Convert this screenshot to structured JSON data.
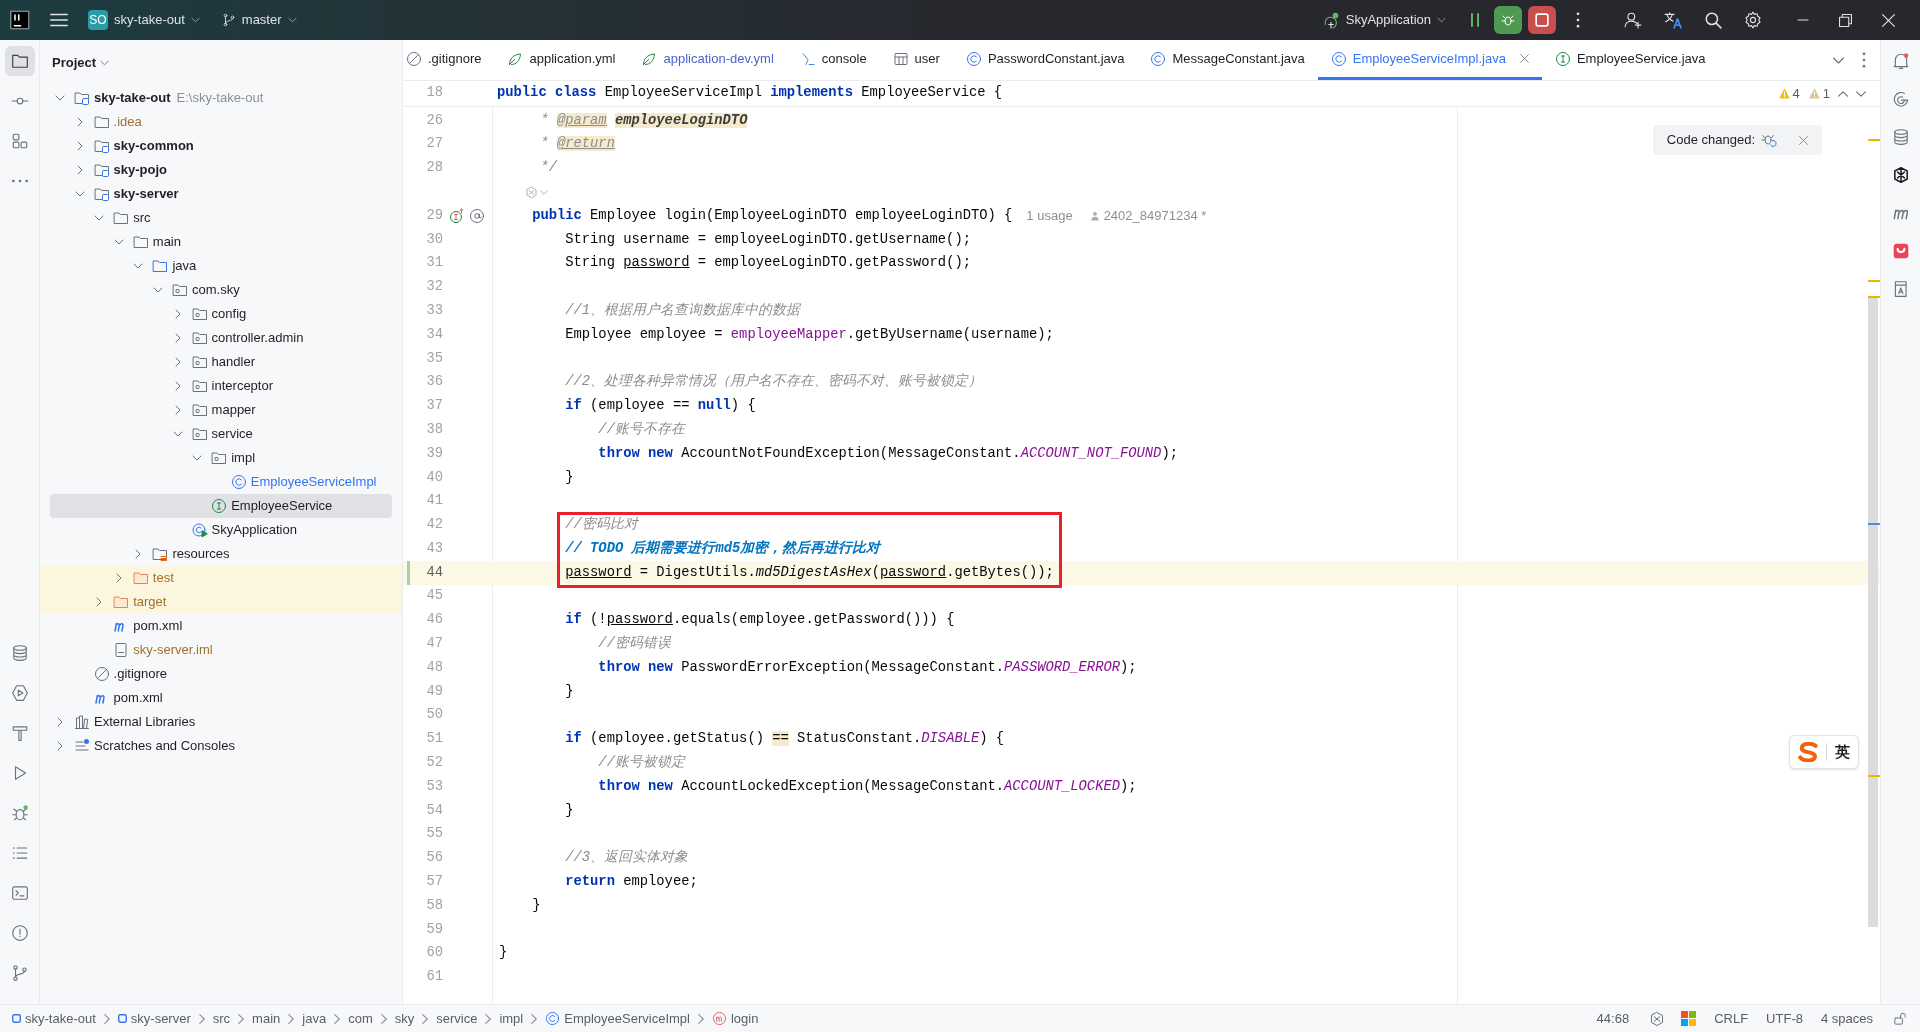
{
  "title_bar": {
    "project_badge": "SO",
    "project": "sky-take-out",
    "branch": "master",
    "run_config": "SkyApplication"
  },
  "left_toolbar": {
    "top": [
      {
        "kind": "folder",
        "selected": true
      },
      {
        "kind": "commit",
        "selected": false
      },
      {
        "kind": "structure",
        "selected": false
      },
      {
        "kind": "more",
        "selected": false
      }
    ],
    "bottom": [
      {
        "kind": "database",
        "selected": false
      },
      {
        "kind": "services",
        "selected": false
      },
      {
        "kind": "build",
        "selected": false
      },
      {
        "kind": "run",
        "selected": false
      },
      {
        "kind": "debug",
        "selected": false
      },
      {
        "kind": "todo",
        "selected": false
      },
      {
        "kind": "terminal",
        "selected": false
      },
      {
        "kind": "problems",
        "selected": false
      },
      {
        "kind": "git",
        "selected": false
      }
    ]
  },
  "right_toolbar": [
    {
      "kind": "bell",
      "selected": false
    },
    {
      "kind": "spiral",
      "selected": false
    },
    {
      "kind": "database",
      "selected": false
    },
    {
      "kind": "hex",
      "selected": false
    },
    {
      "kind": "m",
      "selected": false
    },
    {
      "kind": "app",
      "selected": false
    },
    {
      "kind": "book",
      "selected": false
    }
  ],
  "project_panel": {
    "title": "Project",
    "tree": [
      {
        "label": "sky-take-out",
        "kind": "module",
        "hint": "E:\\sky-take-out",
        "expanded": true,
        "selected": false,
        "ignored": false,
        "modified": false,
        "children": [
          {
            "label": ".idea",
            "kind": "folder",
            "expanded": false,
            "selected": false,
            "ignored": true,
            "modified": false
          },
          {
            "label": "sky-common",
            "kind": "module",
            "expanded": false,
            "selected": false,
            "ignored": false,
            "modified": false
          },
          {
            "label": "sky-pojo",
            "kind": "module",
            "expanded": false,
            "selected": false,
            "ignored": false,
            "modified": false
          },
          {
            "label": "sky-server",
            "kind": "module",
            "expanded": true,
            "selected": false,
            "ignored": false,
            "modified": false,
            "children": [
              {
                "label": "src",
                "kind": "folder",
                "expanded": true,
                "selected": false,
                "ignored": false,
                "modified": false,
                "children": [
                  {
                    "label": "main",
                    "kind": "folder",
                    "expanded": true,
                    "selected": false,
                    "ignored": false,
                    "modified": false,
                    "children": [
                      {
                        "label": "java",
                        "kind": "source",
                        "expanded": true,
                        "selected": false,
                        "ignored": false,
                        "modified": false,
                        "children": [
                          {
                            "label": "com.sky",
                            "kind": "package",
                            "expanded": true,
                            "selected": false,
                            "ignored": false,
                            "modified": false,
                            "children": [
                              {
                                "label": "config",
                                "kind": "package",
                                "expanded": false,
                                "selected": false,
                                "ignored": false,
                                "modified": false
                              },
                              {
                                "label": "controller.admin",
                                "kind": "package",
                                "expanded": false,
                                "selected": false,
                                "ignored": false,
                                "modified": false
                              },
                              {
                                "label": "handler",
                                "kind": "package",
                                "expanded": false,
                                "selected": false,
                                "ignored": false,
                                "modified": false
                              },
                              {
                                "label": "interceptor",
                                "kind": "package",
                                "expanded": false,
                                "selected": false,
                                "ignored": false,
                                "modified": false
                              },
                              {
                                "label": "mapper",
                                "kind": "package",
                                "expanded": false,
                                "selected": false,
                                "ignored": false,
                                "modified": false
                              },
                              {
                                "label": "service",
                                "kind": "package",
                                "expanded": true,
                                "selected": false,
                                "ignored": false,
                                "modified": false,
                                "children": [
                                  {
                                    "label": "impl",
                                    "kind": "package",
                                    "expanded": true,
                                    "selected": false,
                                    "ignored": false,
                                    "modified": false,
                                    "children": [
                                      {
                                        "label": "EmployeeServiceImpl",
                                        "kind": "class",
                                        "selected": false,
                                        "ignored": false,
                                        "modified": true
                                      }
                                    ]
                                  },
                                  {
                                    "label": "EmployeeService",
                                    "kind": "interface",
                                    "selected": true,
                                    "ignored": false,
                                    "modified": false
                                  }
                                ]
                              },
                              {
                                "label": "SkyApplication",
                                "kind": "app-class",
                                "selected": false,
                                "ignored": false,
                                "modified": false
                              }
                            ]
                          }
                        ]
                      },
                      {
                        "label": "resources",
                        "kind": "resources",
                        "expanded": false,
                        "selected": false,
                        "ignored": false,
                        "modified": false
                      }
                    ]
                  },
                  {
                    "label": "test",
                    "kind": "excluded",
                    "expanded": false,
                    "selected": false,
                    "ignored": true,
                    "modified": false
                  }
                ]
              },
              {
                "label": "target",
                "kind": "excluded",
                "expanded": false,
                "selected": false,
                "ignored": true,
                "modified": false
              },
              {
                "label": "pom.xml",
                "kind": "m-file",
                "selected": false,
                "ignored": false,
                "modified": false
              },
              {
                "label": "sky-server.iml",
                "kind": "iml",
                "selected": false,
                "ignored": true,
                "modified": false
              }
            ]
          },
          {
            "label": ".gitignore",
            "kind": "gitignore",
            "selected": false,
            "ignored": false,
            "modified": false
          },
          {
            "label": "pom.xml",
            "kind": "m-file",
            "selected": false,
            "ignored": false,
            "modified": false
          }
        ]
      },
      {
        "label": "External Libraries",
        "kind": "libraries",
        "expanded": false,
        "selected": false,
        "ignored": false,
        "modified": false
      },
      {
        "label": "Scratches and Consoles",
        "kind": "scratches",
        "expanded": false,
        "selected": false,
        "ignored": false,
        "modified": false
      }
    ]
  },
  "tabs": [
    {
      "label": ".gitignore",
      "kind": "gitignore",
      "selected": false,
      "modified": false
    },
    {
      "label": "application.yml",
      "kind": "yml",
      "selected": false,
      "modified": false
    },
    {
      "label": "application-dev.yml",
      "kind": "yml",
      "selected": false,
      "modified": true
    },
    {
      "label": "console",
      "kind": "console",
      "selected": false,
      "modified": false
    },
    {
      "label": "user",
      "kind": "table",
      "selected": false,
      "modified": false
    },
    {
      "label": "PasswordConstant.java",
      "kind": "class",
      "selected": false,
      "modified": false
    },
    {
      "label": "MessageConstant.java",
      "kind": "class",
      "selected": false,
      "modified": false
    },
    {
      "label": "EmployeeServiceImpl.java",
      "kind": "class",
      "selected": true,
      "modified": false
    },
    {
      "label": "EmployeeService.java",
      "kind": "interface",
      "selected": false,
      "modified": false
    }
  ],
  "editor": {
    "sticky_line": {
      "number": "18",
      "tokens": [
        {
          "kind": "keyword",
          "text": "public class"
        },
        {
          "kind": "text",
          "text": " EmployeeServiceImpl "
        },
        {
          "kind": "keyword",
          "text": "implements"
        },
        {
          "kind": "text",
          "text": " EmployeeService {"
        }
      ]
    },
    "inspections": {
      "warnings": "4",
      "weak_warnings": "1"
    },
    "code_changed_popup": {
      "text": "Code changed:"
    },
    "ime_widget": {
      "mode": "英"
    },
    "lines": [
      {
        "kind": "code",
        "number": "26",
        "current": false,
        "changed": false,
        "tokens": [
          {
            "kind": "comment",
            "text": "     * "
          },
          {
            "kind": "doc-tag",
            "text": "@param"
          },
          {
            "kind": "doc-param",
            "text": " employeeLoginDTO"
          }
        ]
      },
      {
        "kind": "code",
        "number": "27",
        "current": false,
        "changed": false,
        "tokens": [
          {
            "kind": "comment",
            "text": "     * "
          },
          {
            "kind": "doc-tag",
            "text": "@return"
          }
        ]
      },
      {
        "kind": "code",
        "number": "28",
        "current": false,
        "changed": false,
        "tokens": [
          {
            "kind": "comment",
            "text": "     */"
          }
        ]
      },
      {
        "kind": "fold-hint"
      },
      {
        "kind": "code",
        "number": "29",
        "current": false,
        "changed": false,
        "gutter_icons": [
          {
            "kind": "implements"
          },
          {
            "kind": "related"
          }
        ],
        "tokens": [
          {
            "kind": "keyword",
            "text": "    public"
          },
          {
            "kind": "text",
            "text": " Employee login(EmployeeLoginDTO employeeLoginDTO) {"
          }
        ],
        "hints": [
          {
            "kind": "usage",
            "text": "1 usage"
          },
          {
            "kind": "author",
            "text": "2402_84971234 *"
          }
        ]
      },
      {
        "kind": "code",
        "number": "30",
        "current": false,
        "changed": false,
        "tokens": [
          {
            "kind": "text",
            "text": "        String username = employeeLoginDTO.getUsername();"
          }
        ]
      },
      {
        "kind": "code",
        "number": "31",
        "current": false,
        "changed": false,
        "tokens": [
          {
            "kind": "text",
            "text": "        String "
          },
          {
            "kind": "reassigned",
            "text": "password"
          },
          {
            "kind": "text",
            "text": " = employeeLoginDTO.getPassword();"
          }
        ]
      },
      {
        "kind": "code",
        "number": "32",
        "current": false,
        "changed": false
      },
      {
        "kind": "code",
        "number": "33",
        "current": false,
        "changed": false,
        "tokens": [
          {
            "kind": "comment",
            "text": "        //1、根据用户名查询数据库中的数据"
          }
        ]
      },
      {
        "kind": "code",
        "number": "34",
        "current": false,
        "changed": false,
        "tokens": [
          {
            "kind": "text",
            "text": "        Employee employee = "
          },
          {
            "kind": "field",
            "text": "employeeMapper"
          },
          {
            "kind": "text",
            "text": ".getByUsername(username);"
          }
        ]
      },
      {
        "kind": "code",
        "number": "35",
        "current": false,
        "changed": false
      },
      {
        "kind": "code",
        "number": "36",
        "current": false,
        "changed": false,
        "tokens": [
          {
            "kind": "comment",
            "text": "        //2、处理各种异常情况（用户名不存在、密码不对、账号被锁定）"
          }
        ]
      },
      {
        "kind": "code",
        "number": "37",
        "current": false,
        "changed": false,
        "tokens": [
          {
            "kind": "keyword",
            "text": "        if"
          },
          {
            "kind": "text",
            "text": " (employee == "
          },
          {
            "kind": "keyword",
            "text": "null"
          },
          {
            "kind": "text",
            "text": ") {"
          }
        ]
      },
      {
        "kind": "code",
        "number": "38",
        "current": false,
        "changed": false,
        "tokens": [
          {
            "kind": "comment",
            "text": "            //账号不存在"
          }
        ]
      },
      {
        "kind": "code",
        "number": "39",
        "current": false,
        "changed": false,
        "tokens": [
          {
            "kind": "keyword",
            "text": "            throw new"
          },
          {
            "kind": "text",
            "text": " AccountNotFoundException(MessageConstant."
          },
          {
            "kind": "constant",
            "text": "ACCOUNT_NOT_FOUND"
          },
          {
            "kind": "text",
            "text": ");"
          }
        ]
      },
      {
        "kind": "code",
        "number": "40",
        "current": false,
        "changed": false,
        "tokens": [
          {
            "kind": "text",
            "text": "        }"
          }
        ]
      },
      {
        "kind": "code",
        "number": "41",
        "current": false,
        "changed": false
      },
      {
        "kind": "highlight-box",
        "lines": [
          {
            "kind": "code",
            "number": "42",
            "current": false,
            "changed": false,
            "tokens": [
              {
                "kind": "comment",
                "text": "        //密码比对"
              }
            ]
          },
          {
            "kind": "code",
            "number": "43",
            "current": false,
            "changed": false,
            "tokens": [
              {
                "kind": "todo",
                "text": "        // TODO 后期需要进行md5加密，然后再进行比对"
              }
            ]
          },
          {
            "kind": "code",
            "number": "44",
            "current": true,
            "changed": true,
            "tokens": [
              {
                "kind": "reassigned",
                "text": "        password"
              },
              {
                "kind": "text",
                "text": " = DigestUtils."
              },
              {
                "kind": "static-call",
                "text": "md5DigestAsHex"
              },
              {
                "kind": "text",
                "text": "("
              },
              {
                "kind": "reassigned",
                "text": "password"
              },
              {
                "kind": "text",
                "text": ".getBytes());"
              }
            ]
          }
        ]
      },
      {
        "kind": "code",
        "number": "45",
        "current": false,
        "changed": false
      },
      {
        "kind": "code",
        "number": "46",
        "current": false,
        "changed": false,
        "tokens": [
          {
            "kind": "keyword",
            "text": "        if"
          },
          {
            "kind": "text",
            "text": " (!"
          },
          {
            "kind": "reassigned",
            "text": "password"
          },
          {
            "kind": "text",
            "text": ".equals(employee.getPassword())) {"
          }
        ]
      },
      {
        "kind": "code",
        "number": "47",
        "current": false,
        "changed": false,
        "tokens": [
          {
            "kind": "comment",
            "text": "            //密码错误"
          }
        ]
      },
      {
        "kind": "code",
        "number": "48",
        "current": false,
        "changed": false,
        "tokens": [
          {
            "kind": "keyword",
            "text": "            throw new"
          },
          {
            "kind": "text",
            "text": " PasswordErrorException(MessageConstant."
          },
          {
            "kind": "constant",
            "text": "PASSWORD_ERROR"
          },
          {
            "kind": "text",
            "text": ");"
          }
        ]
      },
      {
        "kind": "code",
        "number": "49",
        "current": false,
        "changed": false,
        "tokens": [
          {
            "kind": "text",
            "text": "        }"
          }
        ]
      },
      {
        "kind": "code",
        "number": "50",
        "current": false,
        "changed": false
      },
      {
        "kind": "code",
        "number": "51",
        "current": false,
        "changed": false,
        "tokens": [
          {
            "kind": "keyword",
            "text": "        if"
          },
          {
            "kind": "text",
            "text": " (employee.getStatus() "
          },
          {
            "kind": "match",
            "text": "=="
          },
          {
            "kind": "text",
            "text": " StatusConstant."
          },
          {
            "kind": "constant",
            "text": "DISABLE"
          },
          {
            "kind": "text",
            "text": ") {"
          }
        ]
      },
      {
        "kind": "code",
        "number": "52",
        "current": false,
        "changed": false,
        "tokens": [
          {
            "kind": "comment",
            "text": "            //账号被锁定"
          }
        ]
      },
      {
        "kind": "code",
        "number": "53",
        "current": false,
        "changed": false,
        "tokens": [
          {
            "kind": "keyword",
            "text": "            throw new"
          },
          {
            "kind": "text",
            "text": " AccountLockedException(MessageConstant."
          },
          {
            "kind": "constant",
            "text": "ACCOUNT_LOCKED"
          },
          {
            "kind": "text",
            "text": ");"
          }
        ]
      },
      {
        "kind": "code",
        "number": "54",
        "current": false,
        "changed": false,
        "tokens": [
          {
            "kind": "text",
            "text": "        }"
          }
        ]
      },
      {
        "kind": "code",
        "number": "55",
        "current": false,
        "changed": false
      },
      {
        "kind": "code",
        "number": "56",
        "current": false,
        "changed": false,
        "tokens": [
          {
            "kind": "comment",
            "text": "        //3、返回实体对象"
          }
        ]
      },
      {
        "kind": "code",
        "number": "57",
        "current": false,
        "changed": false,
        "tokens": [
          {
            "kind": "keyword",
            "text": "        return"
          },
          {
            "kind": "text",
            "text": " employee;"
          }
        ]
      },
      {
        "kind": "code",
        "number": "58",
        "current": false,
        "changed": false,
        "tokens": [
          {
            "kind": "text",
            "text": "    }"
          }
        ]
      },
      {
        "kind": "code",
        "number": "59",
        "current": false,
        "changed": false
      },
      {
        "kind": "code",
        "number": "60",
        "current": false,
        "changed": false,
        "tokens": [
          {
            "kind": "text",
            "text": "}"
          }
        ]
      },
      {
        "kind": "code",
        "number": "61",
        "current": false,
        "changed": false
      }
    ]
  },
  "status_bar": {
    "breadcrumbs": [
      {
        "label": "sky-take-out",
        "kind": "module"
      },
      {
        "label": "sky-server",
        "kind": "module"
      },
      {
        "label": "src",
        "kind": "plain"
      },
      {
        "label": "main",
        "kind": "plain"
      },
      {
        "label": "java",
        "kind": "plain"
      },
      {
        "label": "com",
        "kind": "plain"
      },
      {
        "label": "sky",
        "kind": "plain"
      },
      {
        "label": "service",
        "kind": "plain"
      },
      {
        "label": "impl",
        "kind": "plain"
      },
      {
        "label": "EmployeeServiceImpl",
        "kind": "class"
      },
      {
        "label": "login",
        "kind": "method"
      }
    ],
    "position": "44:68",
    "line_separator": "CRLF",
    "encoding": "UTF-8",
    "indent": "4 spaces"
  }
}
